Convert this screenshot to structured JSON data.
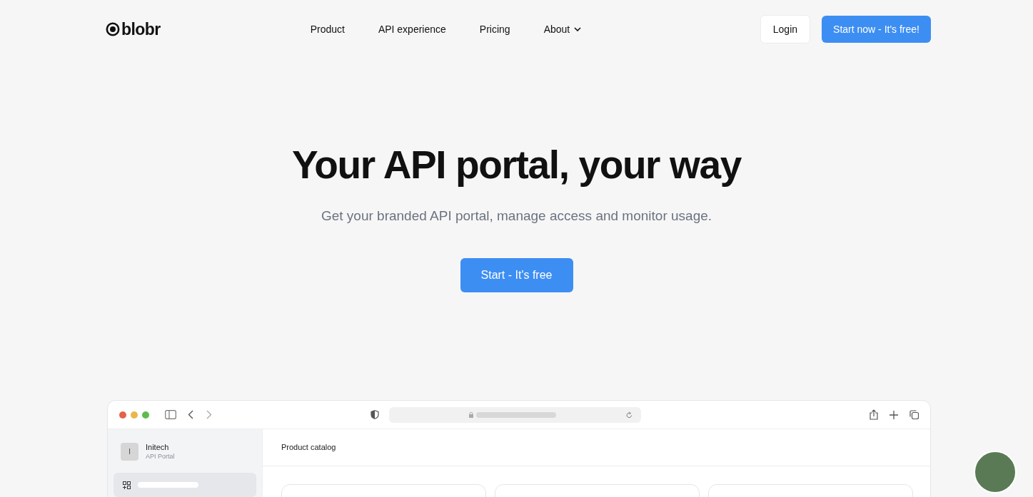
{
  "nav": {
    "logo": "blobr",
    "links": [
      {
        "label": "Product",
        "kind": "link"
      },
      {
        "label": "API experience",
        "kind": "link"
      },
      {
        "label": "Pricing",
        "kind": "link"
      },
      {
        "label": "About",
        "kind": "dropdown"
      }
    ],
    "login": "Login",
    "cta": "Start now - It's free!"
  },
  "hero": {
    "title": "Your API portal, your way",
    "subtitle": "Get your branded API portal, manage access and monitor usage.",
    "button": "Start - It's free"
  },
  "mockup": {
    "org_initial": "I",
    "org_name": "Initech",
    "org_subtitle": "API Portal",
    "page_title": "Product catalog"
  }
}
